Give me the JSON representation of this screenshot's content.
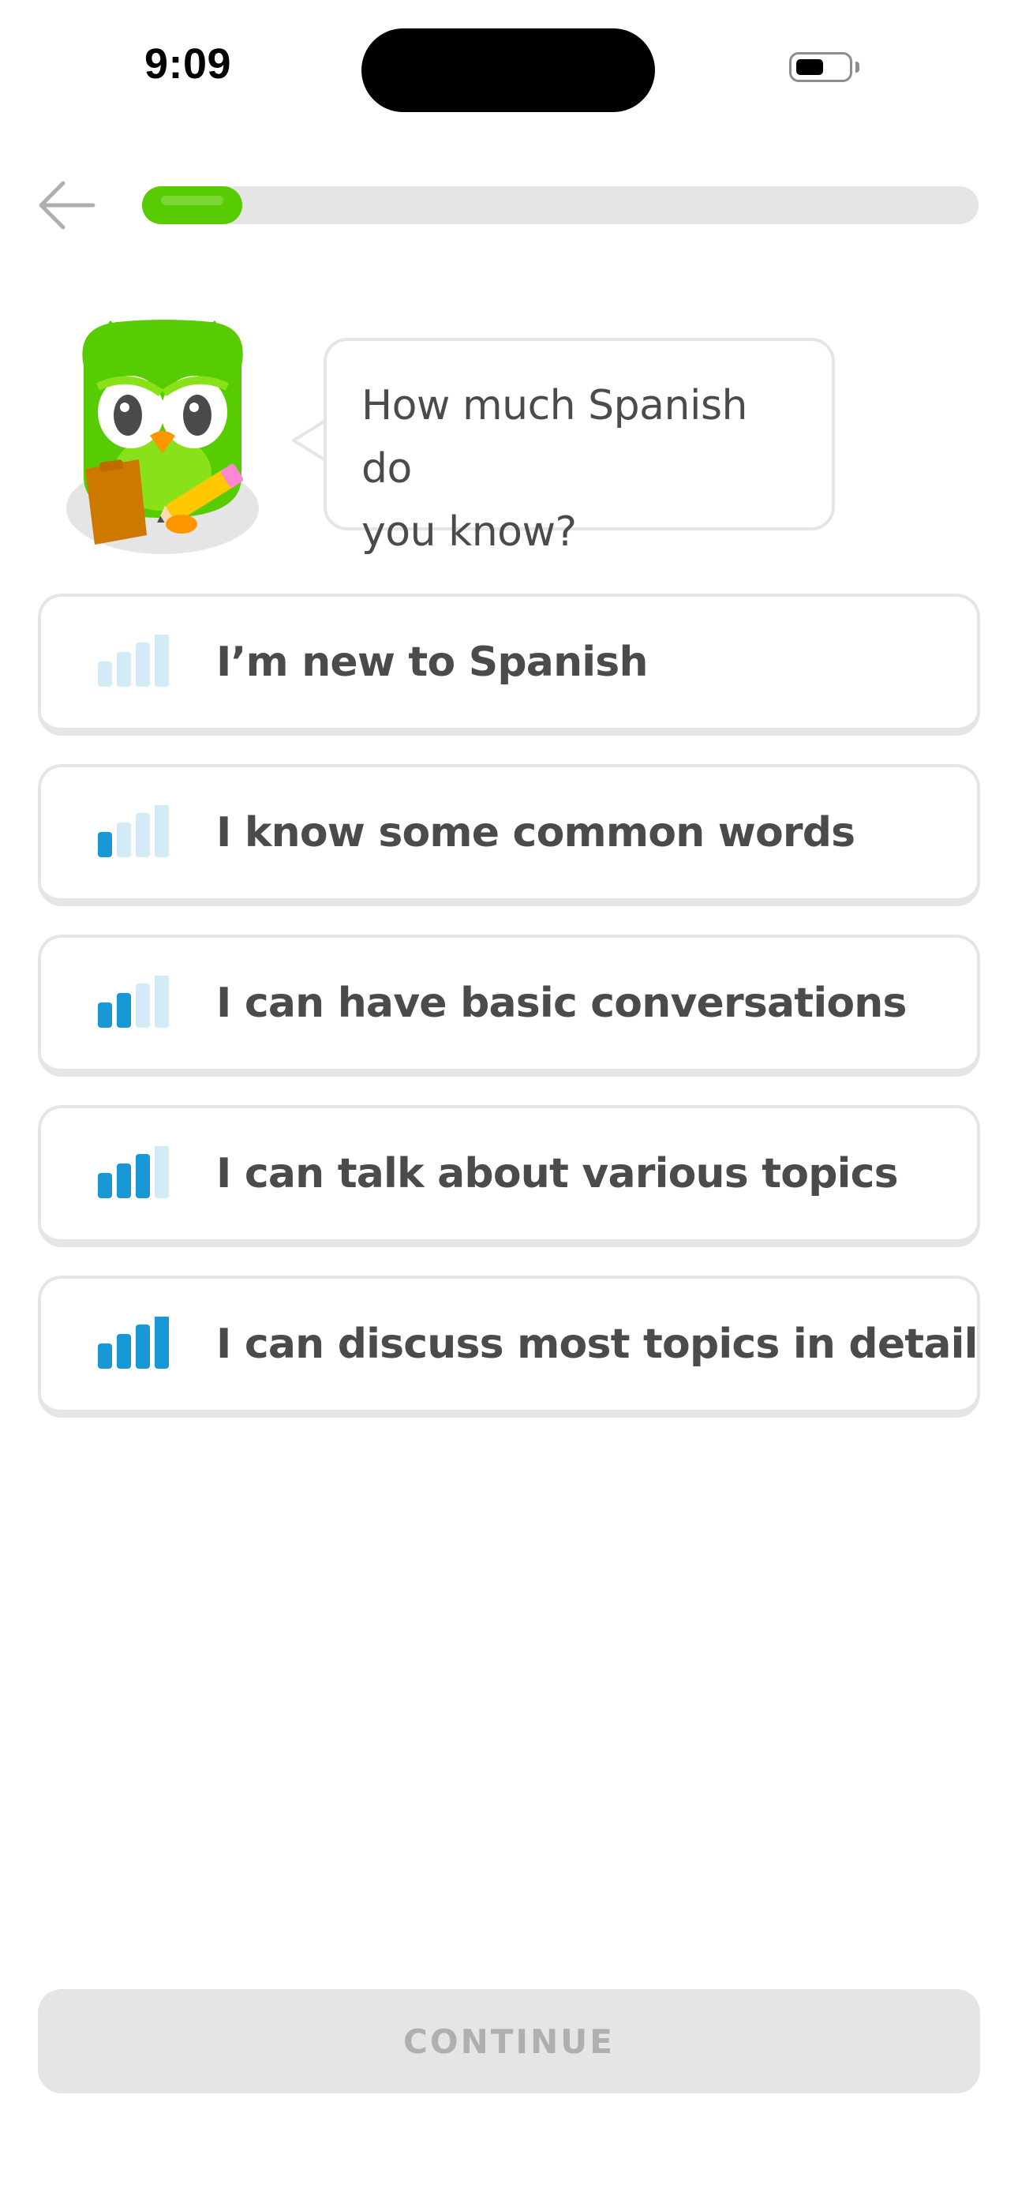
{
  "status_bar": {
    "time": "9:09"
  },
  "top_bar": {
    "back_icon": "arrow-left-icon",
    "progress_fraction": 0.12,
    "progress_color": "#58cc02",
    "track_color": "#e5e5e5"
  },
  "prompt": {
    "mascot_icon": "green-owl-mascot",
    "question": "How much Spanish do you know?",
    "question_line1": "How much Spanish do",
    "question_line2": "you know?"
  },
  "options": [
    {
      "label": "I’m new to Spanish",
      "level": 0,
      "icon": "signal-bars-0-icon"
    },
    {
      "label": "I know some common words",
      "level": 1,
      "icon": "signal-bars-1-icon"
    },
    {
      "label": "I can have basic conversations",
      "level": 2,
      "icon": "signal-bars-2-icon"
    },
    {
      "label": "I can talk about various topics",
      "level": 3,
      "icon": "signal-bars-3-icon"
    },
    {
      "label": "I can discuss most topics in detail",
      "level": 4,
      "icon": "signal-bars-4-icon"
    }
  ],
  "colors": {
    "bar_active": "#1899d6",
    "bar_inactive": "#d3ebf7",
    "border": "#e5e5e5",
    "text": "#4b4b4b"
  },
  "footer": {
    "continue_label": "CONTINUE",
    "continue_enabled": false
  }
}
